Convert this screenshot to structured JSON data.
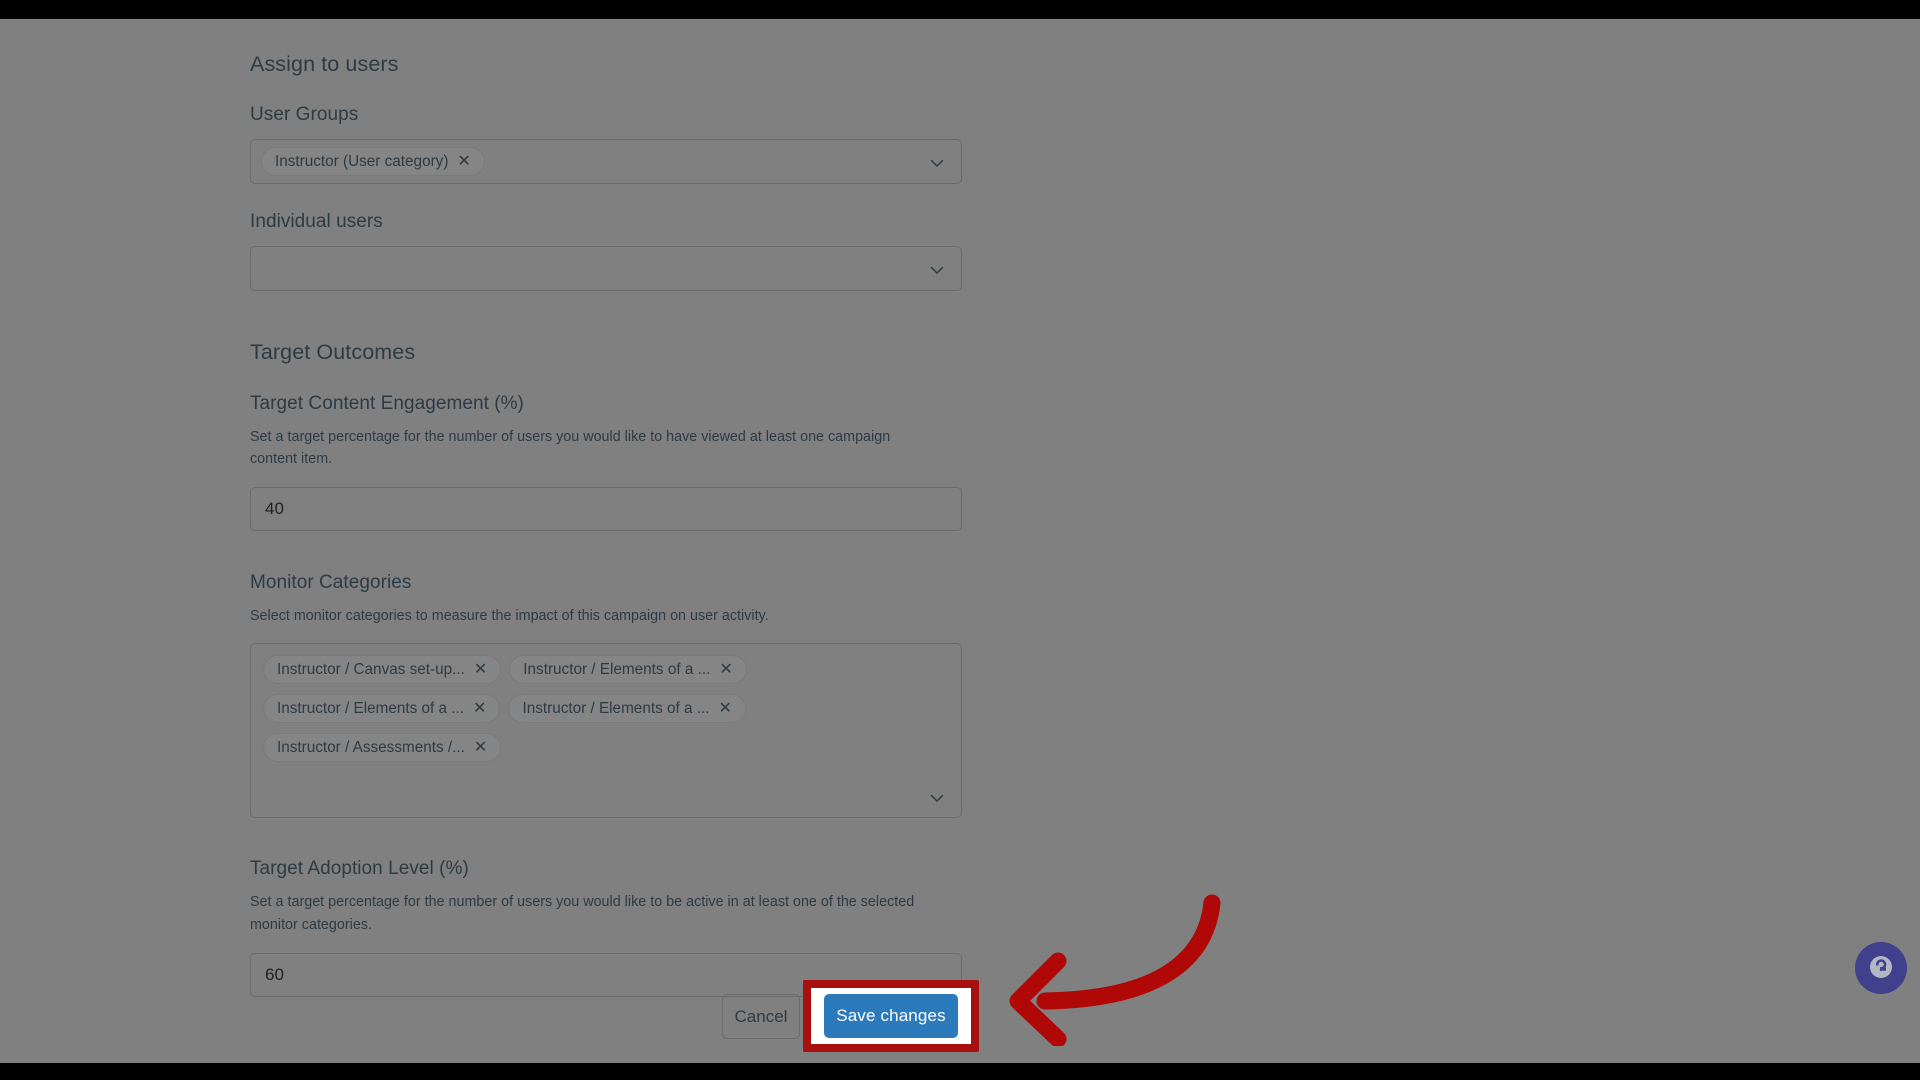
{
  "window": {
    "background_color": "#808080",
    "letterbox_color": "#000000"
  },
  "form": {
    "assign_section_title": "Assign to users",
    "user_groups": {
      "label": "User Groups",
      "chips": [
        {
          "text": "Instructor (User category)",
          "remove_label": "✕"
        }
      ],
      "chevron_icon": "chevron-down-icon"
    },
    "individual_users": {
      "label": "Individual users",
      "value": "",
      "placeholder": "",
      "chevron_icon": "chevron-down-icon"
    },
    "target_section_title": "Target Outcomes",
    "target_content_engagement": {
      "label": "Target Content Engagement (%)",
      "help": "Set a target percentage for the number of users you would like to have viewed at least one campaign content item.",
      "value": "40"
    },
    "monitor_categories": {
      "label": "Monitor Categories",
      "help": "Select monitor categories to measure the impact of this campaign on user activity.",
      "chips": [
        {
          "text": "Instructor / Canvas set-up...",
          "remove_label": "✕"
        },
        {
          "text": "Instructor / Elements of a ...",
          "remove_label": "✕"
        },
        {
          "text": "Instructor / Elements of a ...",
          "remove_label": "✕"
        },
        {
          "text": "Instructor / Elements of a ...",
          "remove_label": "✕"
        },
        {
          "text": "Instructor / Assessments /...",
          "remove_label": "✕"
        }
      ],
      "chevron_icon": "chevron-down-icon"
    },
    "target_adoption_level": {
      "label": "Target Adoption Level (%)",
      "help": "Set a target percentage for the number of users you would like to be active in at least one of the selected monitor categories.",
      "value": "60"
    }
  },
  "actions": {
    "cancel_label": "Cancel",
    "save_label": "Save changes",
    "save_button_color": "#2b7abc",
    "highlight_border_color": "#a80f0f",
    "highlight_fill_color": "#ffffff"
  },
  "annotation": {
    "arrow_icon": "curved-left-arrow-icon",
    "arrow_color": "#b00707"
  },
  "help_widget": {
    "icon": "help-chat-icon",
    "background_color": "#3b3b8f"
  }
}
